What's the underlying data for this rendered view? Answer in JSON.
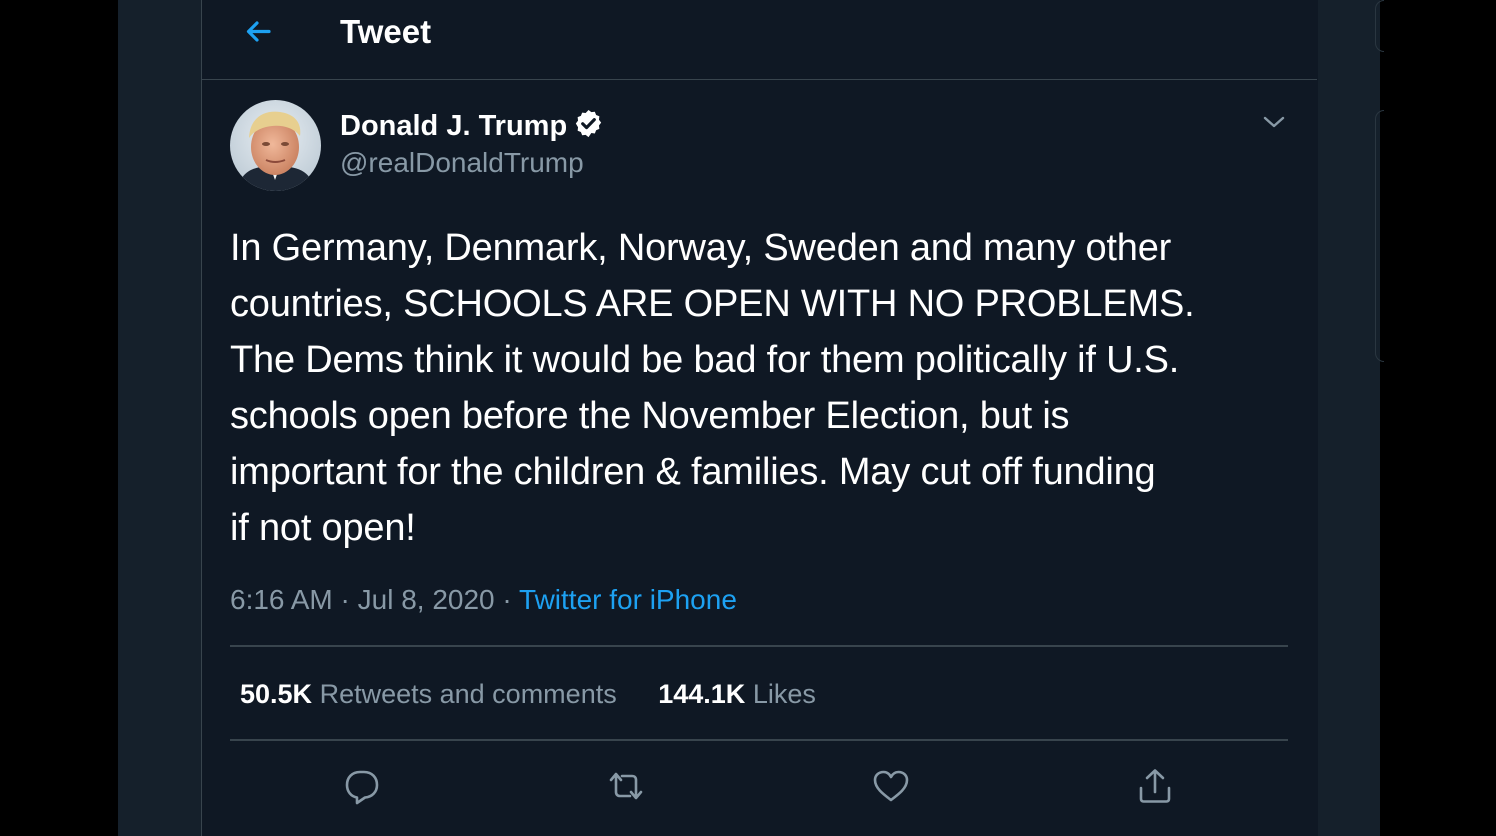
{
  "header": {
    "title": "Tweet",
    "back_icon": "arrow-left-icon"
  },
  "tweet": {
    "author": {
      "display_name": "Donald J. Trump",
      "handle": "@realDonaldTrump",
      "verified_icon": "verified-badge-icon",
      "avatar": "avatar"
    },
    "caret_icon": "chevron-down-icon",
    "text": "In Germany, Denmark, Norway,  Sweden and many other\ncountries, SCHOOLS ARE OPEN WITH NO PROBLEMS.\nThe Dems think it would be bad for them politically if U.S.\nschools open before the November Election, but is\nimportant for the children & families. May cut off funding\nif not open!",
    "time": "6:16 AM",
    "separator": "·",
    "date": "Jul 8, 2020",
    "source": "Twitter for iPhone",
    "stats": {
      "retweets_count": "50.5K",
      "retweets_label": "Retweets and comments",
      "likes_count": "144.1K",
      "likes_label": "Likes"
    },
    "actions": [
      "reply-icon",
      "retweet-icon",
      "like-icon",
      "share-icon"
    ]
  },
  "colors": {
    "background": "#000000",
    "panel": "#0f1824",
    "text_primary": "#ffffff",
    "text_secondary": "#8899a6",
    "accent": "#1da1f2",
    "border": "#38444d"
  }
}
